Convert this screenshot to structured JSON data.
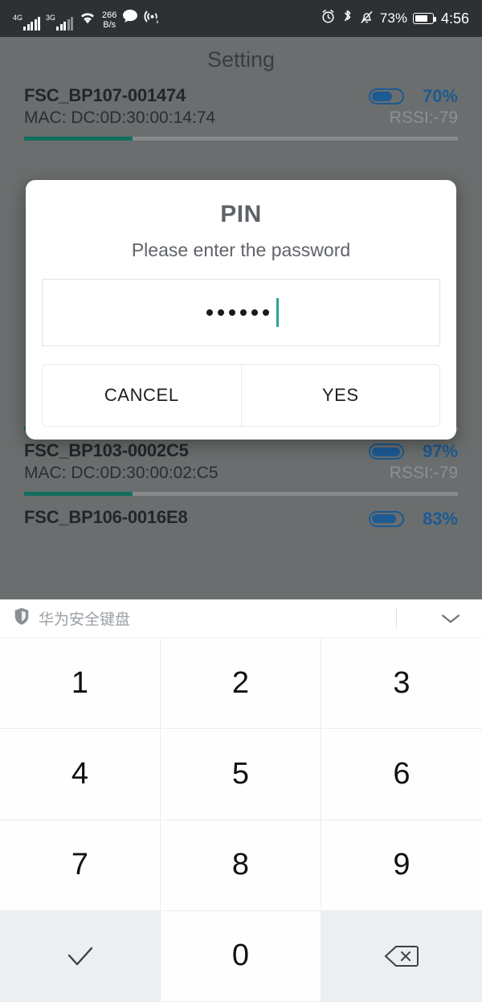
{
  "statusbar": {
    "network_4g_label": "4G",
    "network_3g_label": "3G",
    "netspeed_value": "266",
    "netspeed_unit": "B/s",
    "icons": [
      "signal-4g-icon",
      "signal-3g-icon",
      "wifi-icon",
      "message-icon",
      "location-off-icon",
      "alarm-icon",
      "bluetooth-icon",
      "silent-bell-icon"
    ],
    "battery_percent": "73%",
    "battery_fill": 72,
    "clock": "4:56",
    "background": "#2e3133"
  },
  "app": {
    "title": "Setting",
    "background": "#6b6e6e",
    "accent_battery": "#1c5a93",
    "accent_progress": "#136e5e",
    "devices": [
      {
        "name": "FSC_BP107-001474",
        "mac": "MAC: DC:0D:30:00:14:74",
        "rssi": "RSSI:-79",
        "battery_percent": "70%",
        "battery_fill": 70,
        "progress": 25
      },
      {
        "name": "FSC_BP103-0002C5",
        "mac": "MAC: DC:0D:30:00:02:C5",
        "rssi": "RSSI:-79",
        "battery_percent": "97%",
        "battery_fill": 97,
        "progress": 25
      },
      {
        "name": "FSC_BP106-0016E8",
        "mac": "",
        "rssi": "",
        "battery_percent": "83%",
        "battery_fill": 83,
        "progress": 25
      }
    ]
  },
  "dialog": {
    "title": "PIN",
    "subtitle": "Please enter the password",
    "input_value": "••••••",
    "input_dot_count": 6,
    "cancel_label": "CANCEL",
    "confirm_label": "YES",
    "caret_color": "#2aa394"
  },
  "keyboard": {
    "brand_label": "华为安全键盘",
    "shield_icon": "shield-icon",
    "collapse_icon": "chevron-down-icon",
    "keys": [
      {
        "label": "1",
        "name": "key-1",
        "style": "white"
      },
      {
        "label": "2",
        "name": "key-2",
        "style": "white"
      },
      {
        "label": "3",
        "name": "key-3",
        "style": "white"
      },
      {
        "label": "4",
        "name": "key-4",
        "style": "white"
      },
      {
        "label": "5",
        "name": "key-5",
        "style": "white"
      },
      {
        "label": "6",
        "name": "key-6",
        "style": "white"
      },
      {
        "label": "7",
        "name": "key-7",
        "style": "white"
      },
      {
        "label": "8",
        "name": "key-8",
        "style": "white"
      },
      {
        "label": "9",
        "name": "key-9",
        "style": "white"
      },
      {
        "label": "",
        "name": "key-confirm-check",
        "style": "fn",
        "icon": "check-icon"
      },
      {
        "label": "0",
        "name": "key-0",
        "style": "white"
      },
      {
        "label": "",
        "name": "key-backspace",
        "style": "fn",
        "icon": "backspace-icon"
      }
    ]
  }
}
